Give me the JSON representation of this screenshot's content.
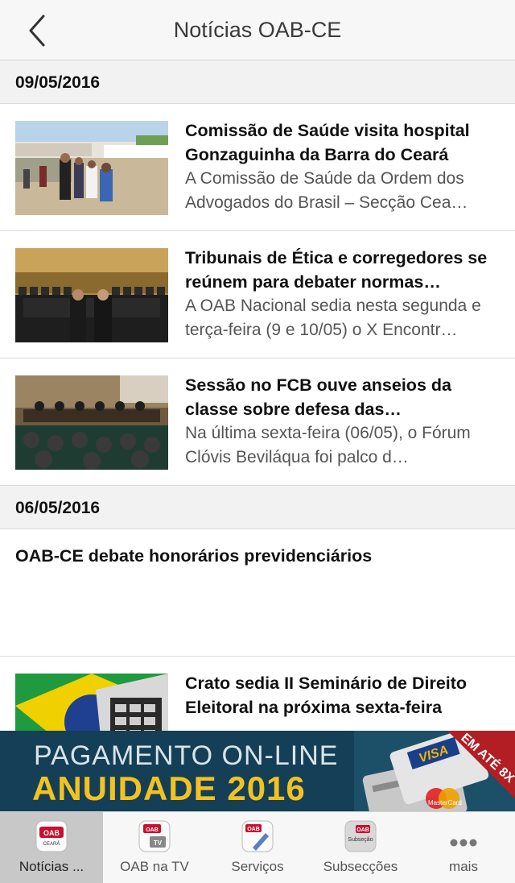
{
  "navbar": {
    "title": "Notícias OAB-CE"
  },
  "sections": [
    {
      "date": "09/05/2016",
      "items": [
        {
          "title": "Comissão de Saúde visita hospital Gonzaguinha da Barra do Ceará",
          "summary": "A Comissão de Saúde da Ordem dos Advogados do Brasil – Secção Cea…"
        },
        {
          "title": "Tribunais de Ética e corregedores se reúnem para debater normas…",
          "summary": "A OAB Nacional sedia nesta segunda e terça-feira (9 e 10/05) o X Encontr…"
        },
        {
          "title": "Sessão no FCB ouve anseios da classe sobre defesa das…",
          "summary": "Na última sexta-feira (06/05), o Fórum Clóvis Beviláqua foi palco d…"
        }
      ]
    },
    {
      "date": "06/05/2016",
      "items": [
        {
          "title": "OAB-CE debate honorários previdenciários",
          "summary": ""
        },
        {
          "title": "Crato sedia II Seminário de Direito Eleitoral na próxima sexta-feira",
          "summary": ""
        }
      ]
    }
  ],
  "banner": {
    "line1": "PAGAMENTO ON-LINE",
    "line2": "ANUIDADE 2016",
    "badge": "EM ATÉ 8X",
    "card_brand_1": "VISA",
    "card_brand_2": "MasterCard"
  },
  "tabs": [
    {
      "label": "Notícias ...",
      "icon": "oab-ceara-icon",
      "active": true
    },
    {
      "label": "OAB na TV",
      "icon": "oab-tv-icon",
      "active": false
    },
    {
      "label": "Serviços",
      "icon": "oab-services-icon",
      "active": false
    },
    {
      "label": "Subsecções",
      "icon": "subsecao-icon",
      "active": false
    },
    {
      "label": "mais",
      "icon": "more-dots-icon",
      "active": false
    }
  ],
  "icon_text": {
    "oab": "OAB",
    "ceara": "CEARÁ",
    "tv": "TV",
    "subsecao": "Subseção"
  },
  "colors": {
    "accent_red": "#c8102e",
    "banner_bg": "#143f56",
    "banner_yellow": "#f2c220"
  }
}
